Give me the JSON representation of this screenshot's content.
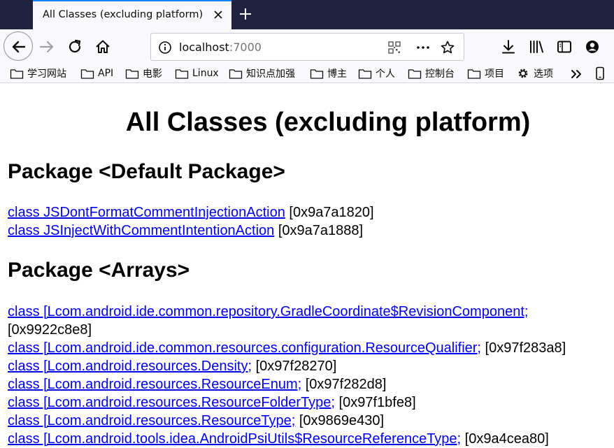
{
  "tab": {
    "title": "All Classes (excluding platform)"
  },
  "urlbar": {
    "host": "localhost",
    "port": ":7000"
  },
  "bookmarks": [
    {
      "label": "学习网站",
      "icon": "folder-icon"
    },
    {
      "label": "API",
      "icon": "folder-icon"
    },
    {
      "label": "电影",
      "icon": "folder-icon"
    },
    {
      "label": "Linux",
      "icon": "folder-icon"
    },
    {
      "label": "知识点加强",
      "icon": "folder-icon"
    },
    {
      "label": "博主",
      "icon": "folder-icon"
    },
    {
      "label": "个人",
      "icon": "folder-icon"
    },
    {
      "label": "控制台",
      "icon": "folder-icon"
    },
    {
      "label": "项目",
      "icon": "folder-icon"
    },
    {
      "label": "选项",
      "icon": "gear-icon"
    }
  ],
  "page": {
    "title": "All Classes (excluding platform)",
    "packages": [
      {
        "heading": "Package <Default Package>",
        "classes": [
          {
            "link": "class JSDontFormatCommentInjectionAction",
            "address": " [0x9a7a1820]"
          },
          {
            "link": "class JSInjectWithCommentIntentionAction",
            "address": " [0x9a7a1888]"
          }
        ]
      },
      {
        "heading": "Package <Arrays>",
        "classes": [
          {
            "link": "class [Lcom.android.ide.common.repository.GradleCoordinate$RevisionComponent;",
            "address": "[0x9922c8e8]"
          },
          {
            "link": "class [Lcom.android.ide.common.resources.configuration.ResourceQualifier;",
            "address": " [0x97f283a8]"
          },
          {
            "link": "class [Lcom.android.resources.Density;",
            "address": " [0x97f28270]"
          },
          {
            "link": "class [Lcom.android.resources.ResourceEnum;",
            "address": " [0x97f282d8]"
          },
          {
            "link": "class [Lcom.android.resources.ResourceFolderType;",
            "address": " [0x97f1bfe8]"
          },
          {
            "link": "class [Lcom.android.resources.ResourceType;",
            "address": " [0x9869e430]"
          },
          {
            "link": "class [Lcom.android.tools.idea.AndroidPsiUtils$ResourceReferenceType;",
            "address": " [0x9a4cea80]"
          }
        ]
      }
    ]
  }
}
